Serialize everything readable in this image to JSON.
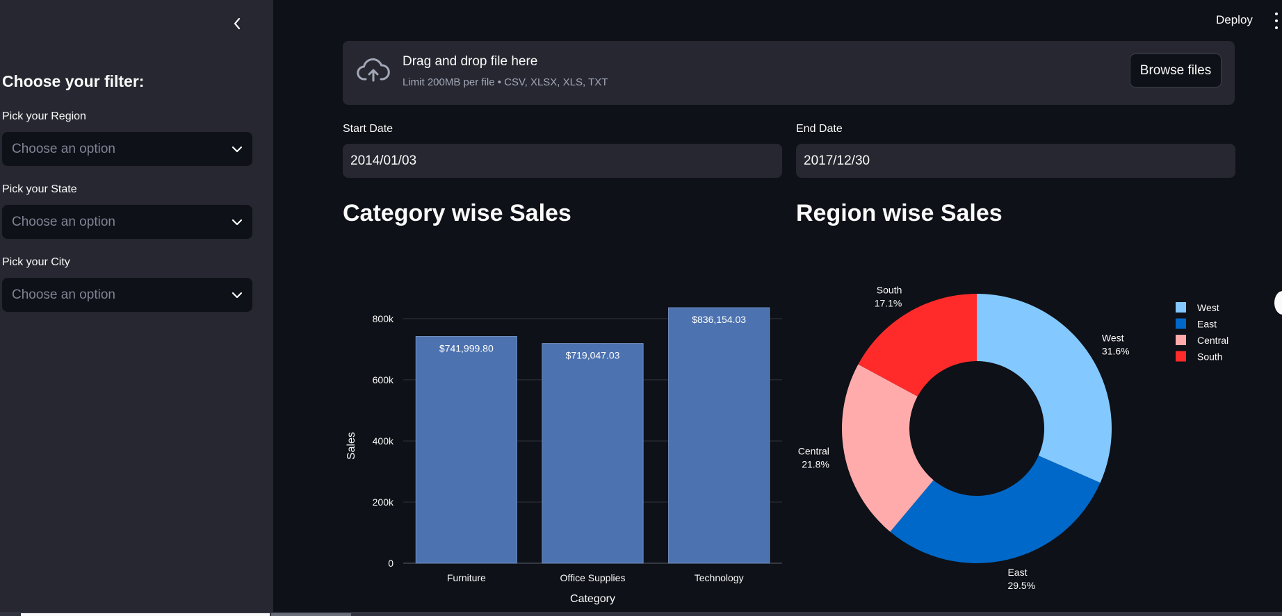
{
  "sidebar": {
    "heading": "Choose your filter:",
    "filters": [
      {
        "label": "Pick your Region",
        "placeholder": "Choose an option"
      },
      {
        "label": "Pick your State",
        "placeholder": "Choose an option"
      },
      {
        "label": "Pick your City",
        "placeholder": "Choose an option"
      }
    ]
  },
  "header": {
    "deploy_label": "Deploy"
  },
  "uploader": {
    "title": "Drag and drop file here",
    "subtitle": "Limit 200MB per file • CSV, XLSX, XLS, TXT",
    "browse_label": "Browse files"
  },
  "dates": {
    "start_label": "Start Date",
    "start_value": "2014/01/03",
    "end_label": "End Date",
    "end_value": "2017/12/30"
  },
  "colors": {
    "bar": "#4c72b0",
    "West": "#83c9ff",
    "East": "#0068c9",
    "Central": "#ffabab",
    "South": "#ff2b2b"
  },
  "chart_data": [
    {
      "type": "bar",
      "title": "Category wise Sales",
      "xlabel": "Category",
      "ylabel": "Sales",
      "categories": [
        "Furniture",
        "Office Supplies",
        "Technology"
      ],
      "values": [
        741999.8,
        719047.03,
        836154.03
      ],
      "data_labels": [
        "$741,999.80",
        "$719,047.03",
        "$836,154.03"
      ],
      "yticks": [
        0,
        200000,
        400000,
        600000,
        800000
      ],
      "ytick_labels": [
        "0",
        "200k",
        "400k",
        "600k",
        "800k"
      ],
      "ylim": [
        0,
        836154.03
      ],
      "grid": true
    },
    {
      "type": "pie",
      "title": "Region wise Sales",
      "hole": true,
      "legend_position": "top-right",
      "labels": [
        "West",
        "East",
        "Central",
        "South"
      ],
      "values": [
        31.6,
        29.5,
        21.8,
        17.1
      ],
      "percent_labels": [
        "31.6%",
        "29.5%",
        "21.8%",
        "17.1%"
      ]
    }
  ]
}
